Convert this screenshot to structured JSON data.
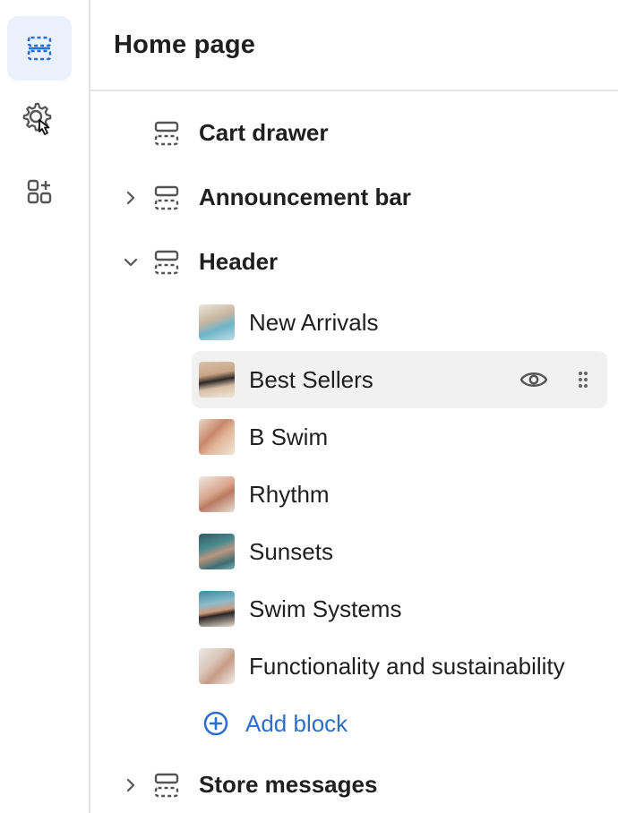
{
  "page": {
    "title": "Home page"
  },
  "sidebar_rail": {
    "items": [
      "sections-icon",
      "settings-icon",
      "app-blocks-icon"
    ]
  },
  "sections": [
    {
      "label": "Cart drawer"
    },
    {
      "label": "Announcement bar"
    },
    {
      "label": "Header"
    }
  ],
  "header_blocks": [
    {
      "label": "New Arrivals"
    },
    {
      "label": "Best Sellers"
    },
    {
      "label": "B Swim"
    },
    {
      "label": "Rhythm"
    },
    {
      "label": "Sunsets"
    },
    {
      "label": "Swim Systems"
    },
    {
      "label": "Functionality and sustainability"
    }
  ],
  "add_block": {
    "label": "Add block"
  },
  "store_messages": {
    "label": "Store messages"
  },
  "colors": {
    "accent": "#2c6ecb",
    "active_rail_bg": "#eaf1fb",
    "hover_row_bg": "#f1f1f1"
  }
}
